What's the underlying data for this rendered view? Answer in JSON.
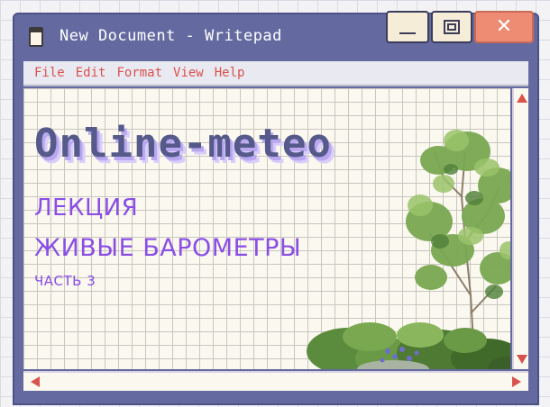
{
  "window": {
    "title": "New Document - Writepad",
    "controls": {
      "minimize_icon": "minimize-icon",
      "maximize_icon": "maximize-icon",
      "close_glyph": "✕"
    }
  },
  "menu": {
    "items": [
      {
        "label": "File"
      },
      {
        "label": "Edit"
      },
      {
        "label": "Format"
      },
      {
        "label": "View"
      },
      {
        "label": "Help"
      }
    ]
  },
  "document": {
    "headline": "Online-meteo",
    "lines": [
      "ЛЕКЦИЯ",
      "ЖИВЫЕ БАРОМЕТРЫ",
      "ЧАСТЬ 3"
    ]
  },
  "colors": {
    "frame": "#646aa0",
    "menu_text": "#d8534c",
    "headline": "#555a8a",
    "subtitle": "#8a4ee4",
    "close_button": "#ed8b73",
    "paper": "#fbf8f0"
  },
  "icons": {
    "document": "document-icon",
    "plant": "plant-illustration"
  }
}
